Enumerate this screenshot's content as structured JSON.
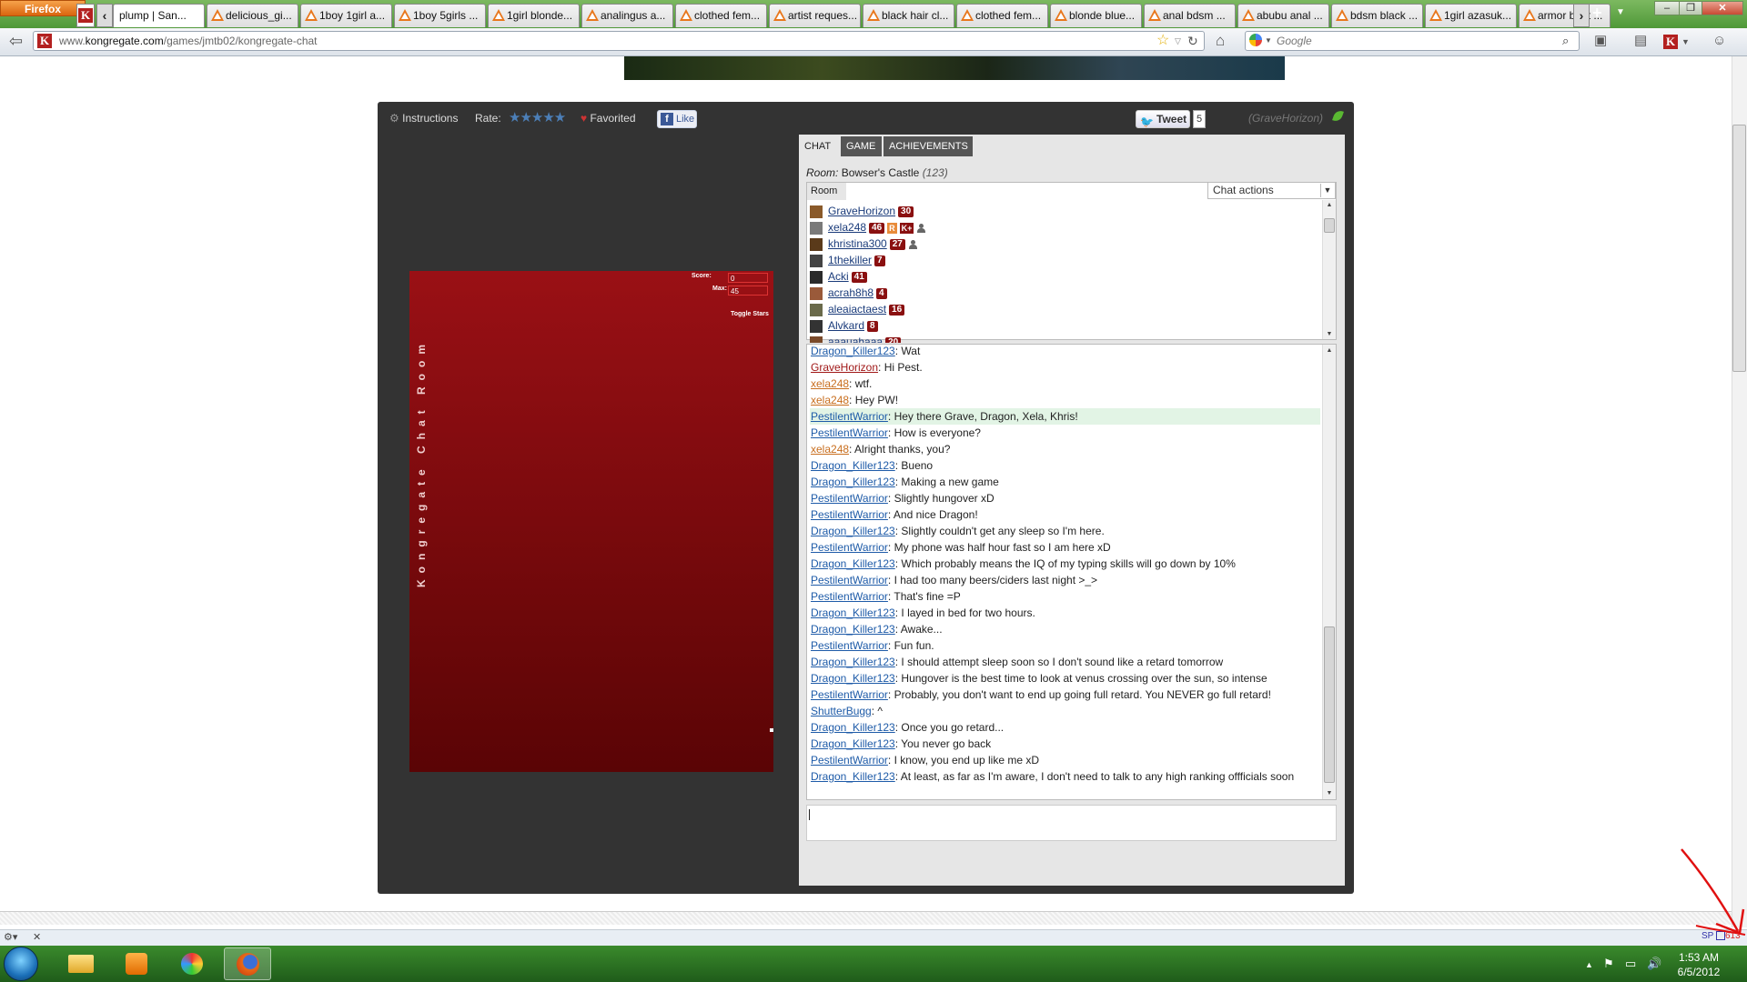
{
  "browser": {
    "menu_button": "Firefox",
    "tabs": [
      {
        "label": "plump | San...",
        "active": true
      },
      {
        "label": "delicious_gi..."
      },
      {
        "label": "1boy 1girl a..."
      },
      {
        "label": "1boy 5girls ..."
      },
      {
        "label": "1girl blonde..."
      },
      {
        "label": "analingus a..."
      },
      {
        "label": "clothed fem..."
      },
      {
        "label": "artist reques..."
      },
      {
        "label": "black hair cl..."
      },
      {
        "label": "clothed fem..."
      },
      {
        "label": "blonde blue..."
      },
      {
        "label": "anal bdsm ..."
      },
      {
        "label": "abubu anal ..."
      },
      {
        "label": "bdsm black ..."
      },
      {
        "label": "1girl azasuk..."
      },
      {
        "label": "armor bent ..."
      }
    ],
    "url_prefix": "www.",
    "url_domain": "kongregate.com",
    "url_path": "/games/jmtb02/kongregate-chat",
    "search_placeholder": "Google"
  },
  "game_bar": {
    "instructions": "Instructions",
    "rate_label": "Rate:",
    "stars": "★★★★★",
    "favorited": "Favorited",
    "fb_like": "Like",
    "tweet": "Tweet",
    "tweet_count": "5",
    "user": "(GraveHorizon)"
  },
  "game": {
    "vertical_title": "Kongregate Chat Room",
    "score_label": "Score:",
    "score_value": "0",
    "max_label": "Max:",
    "max_value": "45",
    "toggle_stars": "Toggle Stars"
  },
  "chat": {
    "tabs": [
      "CHAT",
      "GAME",
      "ACHIEVEMENTS"
    ],
    "room_prefix": "Room:",
    "room_name": "Bowser's Castle",
    "room_count": "(123)",
    "room_tab": "Room",
    "chat_actions": "Chat actions",
    "users": [
      {
        "name": "GraveHorizon",
        "level": "30",
        "avatar": "#8a5a2a"
      },
      {
        "name": "xela248",
        "level": "46",
        "badges": [
          "R",
          "K+"
        ],
        "person": true,
        "avatar": "#7a7a7a"
      },
      {
        "name": "khristina300",
        "level": "27",
        "person": true,
        "avatar": "#5a3a1a"
      },
      {
        "name": "1thekiller",
        "level": "7",
        "avatar": "#444444"
      },
      {
        "name": "Acki",
        "level": "41",
        "avatar": "#2a2a2a"
      },
      {
        "name": "acrah8h8",
        "level": "4",
        "avatar": "#9a5a3a"
      },
      {
        "name": "aleaiactaest",
        "level": "16",
        "avatar": "#6a6a4a"
      },
      {
        "name": "Alvkard",
        "level": "8",
        "avatar": "#333333"
      },
      {
        "name": "aaauahaaa",
        "level": "20",
        "avatar": "#7a4a2a"
      }
    ],
    "messages": [
      {
        "user": "Dragon_Killer123",
        "color": "blue",
        "text": ": Wat"
      },
      {
        "user": "GraveHorizon",
        "color": "red",
        "text": ": Hi Pest."
      },
      {
        "user": "xela248",
        "color": "orange",
        "text": ": wtf."
      },
      {
        "user": "xela248",
        "color": "orange",
        "text": ": Hey PW!"
      },
      {
        "user": "PestilentWarrior",
        "color": "blue",
        "text": ": Hey there Grave, Dragon, Xela, Khris!",
        "highlight": true
      },
      {
        "user": "PestilentWarrior",
        "color": "blue",
        "text": ": How is everyone?"
      },
      {
        "user": "xela248",
        "color": "orange",
        "text": ": Alright thanks, you?"
      },
      {
        "user": "Dragon_Killer123",
        "color": "blue",
        "text": ": Bueno"
      },
      {
        "user": "Dragon_Killer123",
        "color": "blue",
        "text": ": Making a new game"
      },
      {
        "user": "PestilentWarrior",
        "color": "blue",
        "text": ": Slightly hungover xD"
      },
      {
        "user": "PestilentWarrior",
        "color": "blue",
        "text": ": And nice Dragon!"
      },
      {
        "user": "Dragon_Killer123",
        "color": "blue",
        "text": ": Slightly couldn't get any sleep so I'm here."
      },
      {
        "user": "PestilentWarrior",
        "color": "blue",
        "text": ": My phone was half hour fast so I am here xD"
      },
      {
        "user": "Dragon_Killer123",
        "color": "blue",
        "text": ": Which probably means the IQ of my typing skills will go down by 10%"
      },
      {
        "user": "PestilentWarrior",
        "color": "blue",
        "text": ": I had too many beers/ciders last night >_>"
      },
      {
        "user": "PestilentWarrior",
        "color": "blue",
        "text": ": That's fine =P"
      },
      {
        "user": "Dragon_Killer123",
        "color": "blue",
        "text": ": I layed in bed for two hours."
      },
      {
        "user": "Dragon_Killer123",
        "color": "blue",
        "text": ": Awake..."
      },
      {
        "user": "PestilentWarrior",
        "color": "blue",
        "text": ": Fun fun."
      },
      {
        "user": "Dragon_Killer123",
        "color": "blue",
        "text": ": I should attempt sleep soon so I don't sound like a retard tomorrow"
      },
      {
        "user": "Dragon_Killer123",
        "color": "blue",
        "text": ": Hungover is the best time to look at venus crossing over the sun, so intense"
      },
      {
        "user": "PestilentWarrior",
        "color": "blue",
        "text": ": Probably, you don't want to end up going full retard. You NEVER go full retard!"
      },
      {
        "user": "ShutterBugg",
        "color": "blue",
        "text": ": ^"
      },
      {
        "user": "Dragon_Killer123",
        "color": "blue",
        "text": ": Once you go retard..."
      },
      {
        "user": "Dragon_Killer123",
        "color": "blue",
        "text": ": You never go back"
      },
      {
        "user": "PestilentWarrior",
        "color": "blue",
        "text": ": I know, you end up like me xD"
      },
      {
        "user": "Dragon_Killer123",
        "color": "blue",
        "text": ": At least, as far as I'm aware, I don't need to talk to any high ranking offficials soon",
        "wrap": true
      }
    ]
  },
  "addon_bar": {
    "sp": "SP",
    "count": "613"
  },
  "taskbar": {
    "time": "1:53 AM",
    "date": "6/5/2012"
  },
  "colors": {
    "game_bg_top": "#9a1015",
    "chat_link_blue": "#1e5ba8",
    "taskbar_green": "#2e7a24",
    "annotation_red": "#e01010"
  }
}
